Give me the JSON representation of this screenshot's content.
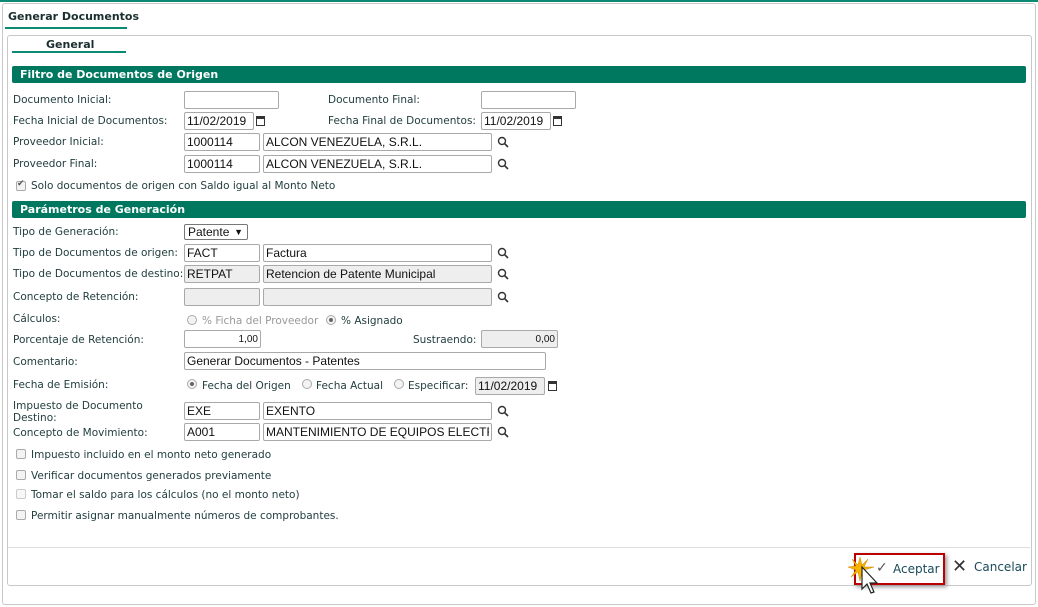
{
  "window": {
    "tab": "Generar Documentos",
    "subtab": "General"
  },
  "filtro": {
    "title": "Filtro de Documentos de Origen",
    "doc_inicial_label": "Documento Inicial:",
    "doc_inicial": "",
    "doc_final_label": "Documento Final:",
    "doc_final": "",
    "fecha_inicial_label": "Fecha Inicial de Documentos:",
    "fecha_inicial": "11/02/2019",
    "fecha_final_label": "Fecha Final de Documentos:",
    "fecha_final": "11/02/2019",
    "prov_inicial_label": "Proveedor Inicial:",
    "prov_inicial_code": "1000114",
    "prov_inicial_name": "ALCON VENEZUELA, S.R.L.",
    "prov_final_label": "Proveedor Final:",
    "prov_final_code": "1000114",
    "prov_final_name": "ALCON VENEZUELA, S.R.L.",
    "solo_label": "Solo documentos de origen con Saldo igual al Monto Neto",
    "solo_checked": true
  },
  "params": {
    "title": "Parámetros de Generación",
    "tipo_gen_label": "Tipo de Generación:",
    "tipo_gen": "Patente",
    "tipo_origen_label": "Tipo de Documentos de origen:",
    "tipo_origen_code": "FACT",
    "tipo_origen_name": "Factura",
    "tipo_destino_label": "Tipo de Documentos de destino:",
    "tipo_destino_code": "RETPAT",
    "tipo_destino_name": "Retencion de Patente Municipal",
    "concepto_ret_label": "Concepto de Retención:",
    "concepto_ret_code": "",
    "concepto_ret_name": "",
    "calculos_label": "Cálculos:",
    "calc_opt1": "% Ficha del Proveedor",
    "calc_opt2": "% Asignado",
    "porcentaje_label": "Porcentaje de Retención:",
    "porcentaje": "1,00",
    "sustraendo_label": "Sustraendo:",
    "sustraendo": "0,00",
    "comentario_label": "Comentario:",
    "comentario": "Generar Documentos - Patentes",
    "fecha_emision_label": "Fecha de Emisión:",
    "fe_opt1": "Fecha del Origen",
    "fe_opt2": "Fecha Actual",
    "fe_opt3": "Especificar:",
    "fe_fecha": "11/02/2019",
    "impuesto_label": "Impuesto de Documento Destino:",
    "impuesto_code": "EXE",
    "impuesto_name": "EXENTO",
    "concepto_mov_label": "Concepto de Movimiento:",
    "concepto_mov_code": "A001",
    "concepto_mov_name": "MANTENIMIENTO DE EQUIPOS ELECTRONICOS",
    "chk1": "Impuesto incluido en el monto neto generado",
    "chk2": "Verificar documentos generados previamente",
    "chk3": "Tomar el saldo para los cálculos (no el monto neto)",
    "chk4": "Permitir asignar manualmente números de comprobantes."
  },
  "buttons": {
    "aceptar": "Aceptar",
    "cancelar": "Cancelar"
  }
}
